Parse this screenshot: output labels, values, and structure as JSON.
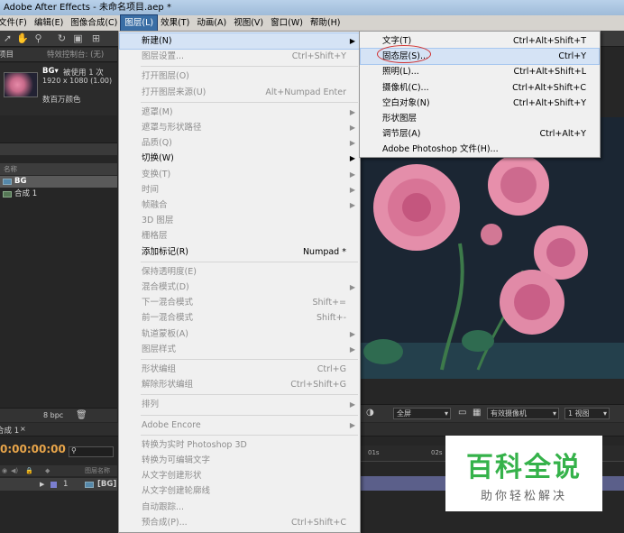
{
  "window": {
    "title": "Adobe After Effects - 未命名项目.aep *"
  },
  "menubar": [
    "文件(F)",
    "编辑(E)",
    "图像合成(C)",
    "图层(L)",
    "效果(T)",
    "动画(A)",
    "视图(V)",
    "窗口(W)",
    "帮助(H)"
  ],
  "project_panel": {
    "tab_label": "项目",
    "effects_tab_label": "特效控制台: (无)",
    "item_name": "BG▾",
    "item_used": "被使用 1 次",
    "item_size": "1920 x 1080 (1.00)",
    "item_color": "数百万颜色",
    "column_name": "名称",
    "items": [
      "BG",
      "合成 1"
    ],
    "bpc": "8 bpc"
  },
  "timeline": {
    "tab_label": "合成 1",
    "timecode": "0:00:00:00",
    "column_name": "图层名称",
    "layer_index": "1",
    "layer_name": "[BG]",
    "ruler_marks": [
      "01s",
      "02s"
    ]
  },
  "viewer_controls": {
    "view": "全屏",
    "camera": "有效摄像机",
    "views": "1 视图"
  },
  "layer_menu": {
    "items": [
      {
        "label": "新建(N)",
        "shortcut": "",
        "submenu": true,
        "disabled": false,
        "highlighted": true
      },
      {
        "label": "图层设置...",
        "shortcut": "Ctrl+Shift+Y",
        "submenu": false,
        "disabled": true
      },
      {
        "sep": true
      },
      {
        "label": "打开图层(O)",
        "shortcut": "",
        "submenu": false,
        "disabled": true
      },
      {
        "label": "打开图层来源(U)",
        "shortcut": "Alt+Numpad Enter",
        "submenu": false,
        "disabled": true
      },
      {
        "sep": true
      },
      {
        "label": "遮罩(M)",
        "shortcut": "",
        "submenu": true,
        "disabled": true
      },
      {
        "label": "遮罩与形状路径",
        "shortcut": "",
        "submenu": true,
        "disabled": true
      },
      {
        "label": "品质(Q)",
        "shortcut": "",
        "submenu": true,
        "disabled": true
      },
      {
        "label": "切换(W)",
        "shortcut": "",
        "submenu": true,
        "disabled": false
      },
      {
        "label": "变换(T)",
        "shortcut": "",
        "submenu": true,
        "disabled": true
      },
      {
        "label": "时间",
        "shortcut": "",
        "submenu": true,
        "disabled": true
      },
      {
        "label": "帧融合",
        "shortcut": "",
        "submenu": true,
        "disabled": true
      },
      {
        "label": "3D 图层",
        "shortcut": "",
        "submenu": false,
        "disabled": true
      },
      {
        "label": "栅格层",
        "shortcut": "",
        "submenu": false,
        "disabled": true
      },
      {
        "label": "添加标记(R)",
        "shortcut": "Numpad *",
        "submenu": false,
        "disabled": false
      },
      {
        "sep": true
      },
      {
        "label": "保持透明度(E)",
        "shortcut": "",
        "submenu": false,
        "disabled": true
      },
      {
        "label": "混合模式(D)",
        "shortcut": "",
        "submenu": true,
        "disabled": true
      },
      {
        "label": "下一混合模式",
        "shortcut": "Shift+=",
        "submenu": false,
        "disabled": true
      },
      {
        "label": "前一混合模式",
        "shortcut": "Shift+-",
        "submenu": false,
        "disabled": true
      },
      {
        "label": "轨道蒙板(A)",
        "shortcut": "",
        "submenu": true,
        "disabled": true
      },
      {
        "label": "图层样式",
        "shortcut": "",
        "submenu": true,
        "disabled": true
      },
      {
        "sep": true
      },
      {
        "label": "形状编组",
        "shortcut": "Ctrl+G",
        "submenu": false,
        "disabled": true
      },
      {
        "label": "解除形状编组",
        "shortcut": "Ctrl+Shift+G",
        "submenu": false,
        "disabled": true
      },
      {
        "sep": true
      },
      {
        "label": "排列",
        "shortcut": "",
        "submenu": true,
        "disabled": true
      },
      {
        "sep": true
      },
      {
        "label": "Adobe Encore",
        "shortcut": "",
        "submenu": true,
        "disabled": true
      },
      {
        "sep": true
      },
      {
        "label": "转换为实时 Photoshop 3D",
        "shortcut": "",
        "submenu": false,
        "disabled": true
      },
      {
        "label": "转换为可编辑文字",
        "shortcut": "",
        "submenu": false,
        "disabled": true
      },
      {
        "label": "从文字创建形状",
        "shortcut": "",
        "submenu": false,
        "disabled": true
      },
      {
        "label": "从文字创建轮廓线",
        "shortcut": "",
        "submenu": false,
        "disabled": true
      },
      {
        "label": "自动跟踪...",
        "shortcut": "",
        "submenu": false,
        "disabled": true
      },
      {
        "label": "预合成(P)...",
        "shortcut": "Ctrl+Shift+C",
        "submenu": false,
        "disabled": true
      }
    ]
  },
  "new_submenu": {
    "items": [
      {
        "label": "文字(T)",
        "shortcut": "Ctrl+Alt+Shift+T"
      },
      {
        "label": "固态层(S)...",
        "shortcut": "Ctrl+Y",
        "highlighted": true
      },
      {
        "label": "照明(L)...",
        "shortcut": "Ctrl+Alt+Shift+L"
      },
      {
        "label": "摄像机(C)...",
        "shortcut": "Ctrl+Alt+Shift+C"
      },
      {
        "label": "空白对象(N)",
        "shortcut": "Ctrl+Alt+Shift+Y"
      },
      {
        "label": "形状图层",
        "shortcut": ""
      },
      {
        "label": "调节层(A)",
        "shortcut": "Ctrl+Alt+Y"
      },
      {
        "label": "Adobe Photoshop 文件(H)...",
        "shortcut": ""
      }
    ]
  },
  "watermark": {
    "title": "百科全说",
    "subtitle": "助你轻松解决"
  }
}
